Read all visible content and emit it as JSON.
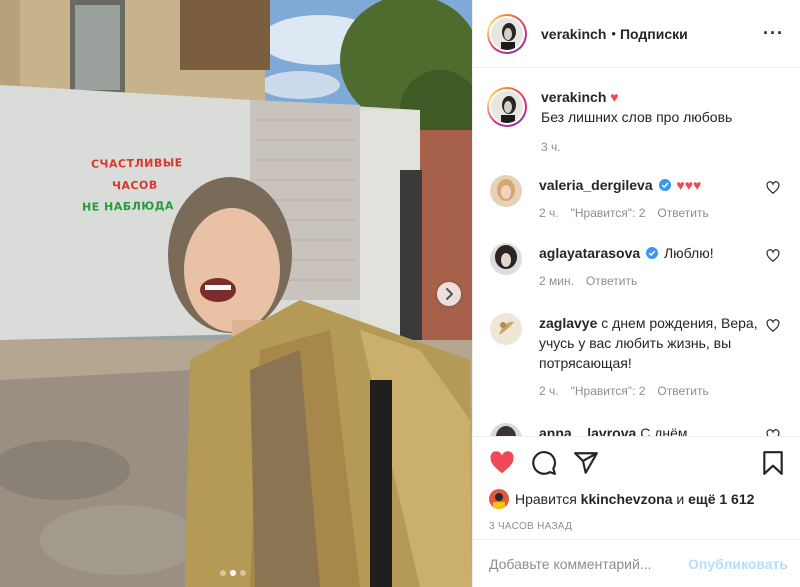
{
  "photo": {
    "wall_text": [
      "СЧАСТЛИВЫЕ",
      "ЧАСОВ",
      "НЕ НАБЛЮДА"
    ],
    "next_icon": "chevron-right-icon",
    "carousel": {
      "count": 3,
      "active_index": 1
    }
  },
  "header": {
    "username": "verakinch",
    "separator": "•",
    "follow_label": "Подписки",
    "more_label": "···"
  },
  "caption": {
    "username": "verakinch",
    "heart": "♥",
    "text": "Без лишних слов про любовь",
    "time": "3 ч."
  },
  "comments": [
    {
      "username": "valeria_dergileva",
      "verified": true,
      "text": "♥♥♥",
      "time": "2 ч.",
      "likes": "\"Нравится\": 2",
      "reply": "Ответить"
    },
    {
      "username": "aglayatarasova",
      "verified": true,
      "text": "Люблю!",
      "time": "2 мин.",
      "likes": "",
      "reply": "Ответить"
    },
    {
      "username": "zaglavye",
      "verified": false,
      "text": "с днем рождения, Вера, учусь у вас любить жизнь, вы потрясающая!",
      "time": "2 ч.",
      "likes": "\"Нравится\": 2",
      "reply": "Ответить"
    },
    {
      "username": "anna__lavrova",
      "verified": false,
      "text": "С днём",
      "time": "",
      "likes": "",
      "reply": ""
    }
  ],
  "actions": {
    "like_icon": "heart-filled-icon",
    "comment_icon": "comment-icon",
    "share_icon": "share-icon",
    "save_icon": "bookmark-icon",
    "likes_prefix": "Нравится",
    "likes_user": "kkinchevzona",
    "likes_and": "и",
    "likes_rest": "ещё 1 612",
    "time_ago": "3 ЧАСОВ НАЗАД"
  },
  "add_comment": {
    "placeholder": "Добавьте комментарий...",
    "publish_label": "Опубликовать"
  },
  "colors": {
    "like_red": "#ed4956",
    "verified_blue": "#3897f0",
    "publish_disabled": "#b2dffc",
    "secondary_text": "#8e8e8e"
  }
}
